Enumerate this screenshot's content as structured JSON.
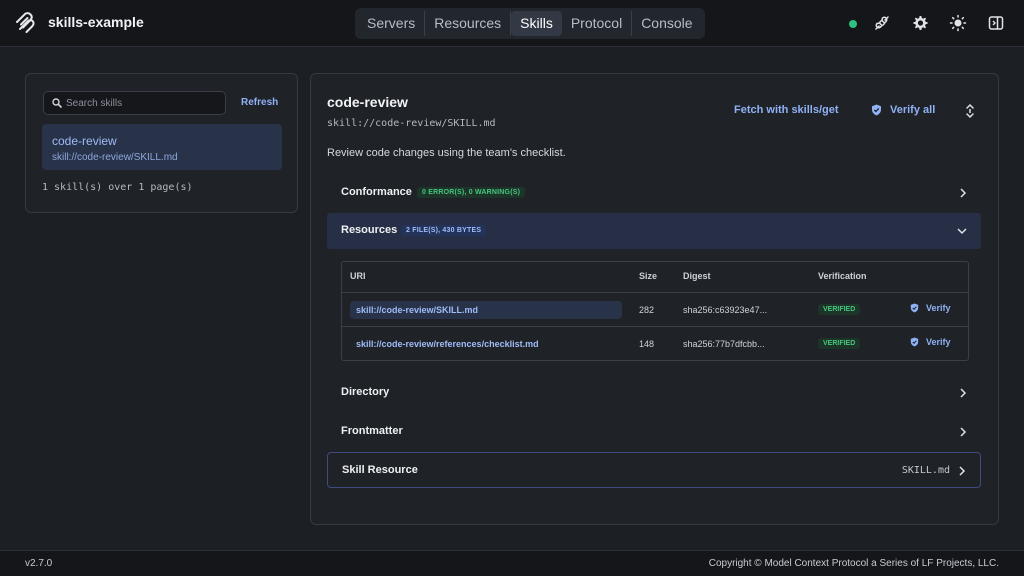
{
  "app": {
    "title": "skills-example"
  },
  "nav": {
    "items": [
      {
        "label": "Servers"
      },
      {
        "label": "Resources"
      },
      {
        "label": "Skills"
      },
      {
        "label": "Protocol"
      },
      {
        "label": "Console"
      }
    ],
    "active": "Skills"
  },
  "header": {
    "status_color": "#2ec27e",
    "icons": [
      "plug-icon",
      "gear-icon",
      "sun-icon",
      "sidebar-toggle-icon"
    ]
  },
  "sidebar": {
    "search_placeholder": "Search skills",
    "refresh_label": "Refresh",
    "items": [
      {
        "name": "code-review",
        "uri": "skill://code-review/SKILL.md"
      }
    ],
    "page_info": "1 skill(s) over 1 page(s)"
  },
  "detail": {
    "title": "code-review",
    "uri": "skill://code-review/SKILL.md",
    "fetch_label": "Fetch with skills/get",
    "verify_all_label": "Verify all",
    "description": "Review code changes using the team's checklist.",
    "sections": {
      "conformance": {
        "title": "Conformance",
        "badge": "0 ERROR(S), 0 WARNING(S)"
      },
      "resources": {
        "title": "Resources",
        "badge": "2 FILE(S), 430 BYTES"
      },
      "directory": {
        "title": "Directory"
      },
      "frontmatter": {
        "title": "Frontmatter"
      },
      "skill_resource": {
        "title": "Skill Resource",
        "file": "SKILL.md"
      }
    },
    "resources_table": {
      "headers": {
        "uri": "URI",
        "size": "Size",
        "digest": "Digest",
        "verification": "Verification"
      },
      "rows": [
        {
          "uri": "skill://code-review/SKILL.md",
          "size": "282",
          "digest": "sha256:c63923e47...",
          "status": "VERIFIED",
          "action": "Verify"
        },
        {
          "uri": "skill://code-review/references/checklist.md",
          "size": "148",
          "digest": "sha256:77b7dfcbb...",
          "status": "VERIFIED",
          "action": "Verify"
        }
      ]
    }
  },
  "footer": {
    "version": "v2.7.0",
    "copyright": "Copyright © Model Context Protocol a Series of LF Projects, LLC."
  }
}
